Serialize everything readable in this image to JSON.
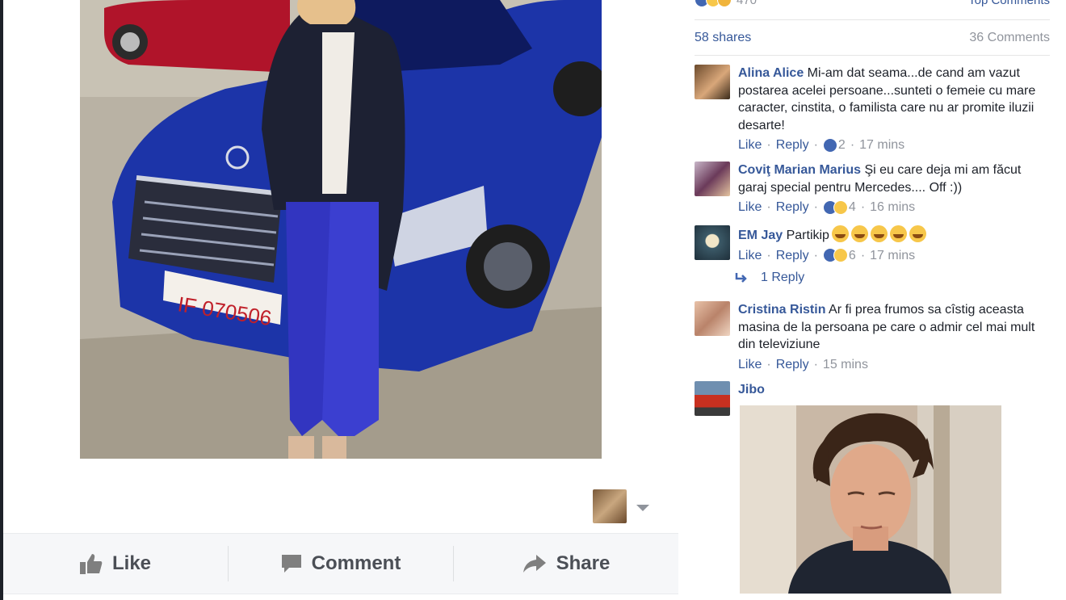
{
  "post": {
    "actions": {
      "like_label": "Like",
      "comment_label": "Comment",
      "share_label": "Share"
    }
  },
  "sidebar": {
    "reaction_count": "470",
    "sort_label": "Top Comments",
    "shares": "58 shares",
    "comments_count": "36 Comments",
    "comments": [
      {
        "author": "Alina Alice",
        "text": "Mi-am dat seama...de cand am vazut postarea acelei persoane...sunteti o femeie cu mare caracter, cinstita, o familista care nu ar promite iluzii desarte!",
        "like": "Like",
        "reply": "Reply",
        "reactions": "2",
        "time": "17 mins"
      },
      {
        "author": "Coviţ Marian Marius",
        "text": "Şi eu care deja mi am făcut garaj special pentru Mercedes.... Off :))",
        "like": "Like",
        "reply": "Reply",
        "reactions": "4",
        "time": "16 mins"
      },
      {
        "author": "EM Jay",
        "text": "Partikip",
        "like": "Like",
        "reply": "Reply",
        "reactions": "6",
        "time": "17 mins",
        "replies_label": "1 Reply"
      },
      {
        "author": "Cristina Ristin",
        "text": "Ar fi prea frumos sa cîstig aceasta masina de la persoana pe care o admir cel mai mult din televiziune",
        "like": "Like",
        "reply": "Reply",
        "time": "15 mins"
      },
      {
        "author": "Jibo"
      }
    ]
  },
  "colors": {
    "link_blue": "#365899",
    "meta_gray": "#90949c",
    "bar_bg": "#f6f7f9",
    "like_blue": "#4267b2"
  }
}
